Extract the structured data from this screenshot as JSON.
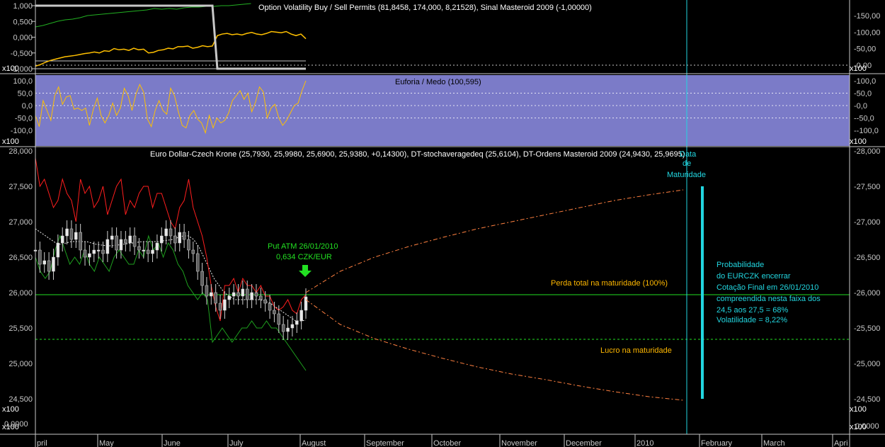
{
  "colors": {
    "background": "#000000",
    "panel_bg": "#7b7bc8",
    "grid_dotted": "#c8c8c8",
    "red_band": "#ff1e1e",
    "green_band": "#1ea01e",
    "yellow": "#ffc000",
    "cyan": "#22d6e0",
    "green_text": "#22e022",
    "orange": "#ff8040",
    "gold_text": "#ffb800",
    "light_green": "#90d890"
  },
  "panel1": {
    "title": "Option Volatility Buy / Sell Permits (81,8458, 174,000, 8,21528), Sinal Masteroid 2009 (-1,00000)",
    "scale_tag": "x100",
    "left_ticks": [
      "1,000",
      "0,500",
      "0,000",
      "-0,500",
      "-1,000"
    ],
    "right_ticks": [
      "150,00",
      "100,00",
      "50,00",
      "0,00"
    ]
  },
  "panel2": {
    "title": "Euforia / Medo (100,595)",
    "scale_tag": "x100",
    "ticks": [
      "100,0",
      "50,0",
      "0,0",
      "-50,0",
      "-100,0"
    ]
  },
  "panel3": {
    "title": "Euro Dollar-Czech Krone (25,7930, 25,9980, 25,6900, 25,9380, +0,14300), DT-stochaveragedeq (25,6104), DT-Ordens Masteroid 2009 (24,9430, 25,9695)",
    "scale_tag": "x100",
    "ticks": [
      "28,000",
      "27,500",
      "27,000",
      "26,500",
      "26,000",
      "25,500",
      "25,000",
      "24,500"
    ],
    "bottom_tick": "0,0000"
  },
  "annotations": {
    "put": [
      "Put ATM 26/01/2010",
      "0,634 CZK/EUR"
    ],
    "expiry": [
      "Data",
      "de",
      "Maturidade"
    ],
    "loss": "Perda total na maturidade (100%)",
    "profit": "Lucro na maturidade",
    "probability": [
      "Probabilidade",
      "do EURCZK encerrar",
      "Cotação Final em 26/01/2010",
      "compreendida nesta faixa dos",
      "24,5 aos 27,5 = 68%",
      "Volatilidade = 8,22%"
    ]
  },
  "x_axis": [
    "pril",
    "May",
    "June",
    "July",
    "August",
    "September",
    "October",
    "November",
    "December",
    "2010",
    "February",
    "March",
    "Apri"
  ],
  "chart_data": [
    {
      "type": "line",
      "title": "Option Volatility Buy / Sell Permits (81,8458, 174,000, 8,21528), Sinal Masteroid 2009 (-1,00000)",
      "series": [
        {
          "name": "Option Volatility Buy / Sell Permits",
          "color": "#ffc000",
          "values": [
            -0.92,
            -0.87,
            -0.8,
            -0.74,
            -0.7,
            -0.66,
            -0.62,
            -0.6,
            -0.58,
            -0.55,
            -0.52,
            -0.5,
            -0.47,
            -0.5,
            -0.43,
            -0.45,
            -0.36,
            -0.4,
            -0.38,
            -0.42,
            -0.35,
            -0.4,
            -0.38,
            -0.5,
            -0.48,
            -0.42,
            -0.4,
            -0.35,
            -0.37,
            -0.3,
            -0.3,
            -0.28,
            -0.35,
            -0.32,
            -0.27,
            -0.3,
            -0.28,
            0.05,
            0.1,
            0.12,
            0.08,
            0.1,
            0.07,
            0.12,
            0.15,
            0.1,
            0.08,
            0.12,
            0.18,
            0.16,
            0.14,
            0.18,
            0.1,
            0.05,
            0.1,
            -0.05
          ]
        },
        {
          "name": "Sinal Masteroid 2009",
          "color": "#c8c8c8",
          "values": [
            1,
            1,
            1,
            1,
            1,
            1,
            1,
            1,
            1,
            1,
            1,
            1,
            1,
            1,
            1,
            1,
            1,
            1,
            1,
            1,
            1,
            1,
            1,
            1,
            1,
            1,
            1,
            1,
            1,
            1,
            1,
            1,
            1,
            1,
            1,
            1,
            1,
            -1,
            -1,
            -1,
            -1,
            -1,
            -1,
            -1,
            -1,
            -1,
            -1,
            -1,
            -1,
            -1,
            -1,
            -1,
            -1,
            -1,
            -1,
            -1
          ]
        }
      ]
    },
    {
      "type": "line",
      "title": "Euforia / Medo (100,595)",
      "series": [
        {
          "name": "Euforia / Medo",
          "color": "#ffc000",
          "values": [
            -40,
            -85,
            20,
            -20,
            -60,
            40,
            75,
            5,
            35,
            40,
            -15,
            -10,
            -20,
            -10,
            -80,
            -15,
            30,
            -40,
            -70,
            -40,
            10,
            -40,
            -10,
            70,
            40,
            -20,
            45,
            85,
            55,
            -55,
            -85,
            -20,
            20,
            -20,
            -35,
            70,
            40,
            -25,
            -80,
            -90,
            -40,
            -20,
            -55,
            -70,
            -110,
            -40,
            -90,
            -50,
            -70,
            -60,
            -30,
            20,
            40,
            60,
            25,
            50,
            -25,
            15,
            75,
            55,
            -50,
            -10,
            5,
            -50,
            -80,
            -60,
            -30,
            0,
            10,
            60,
            100
          ]
        }
      ]
    },
    {
      "type": "line",
      "title": "Euro Dollar-Czech Krone (25,7930, 25,9980, 25,6900, 25,9380, +0,14300), DT-stochaveragedeq (25,6104), DT-Ordens Masteroid 2009 (24,9430, 25,9695)",
      "ylim": [
        24.4,
        28.0
      ],
      "categories": [
        "pril",
        "May",
        "June",
        "July",
        "August",
        "September",
        "October",
        "November",
        "December",
        "2010",
        "February",
        "March",
        "Apri"
      ],
      "series": [
        {
          "name": "Euro Dollar-Czech Krone",
          "type": "candlestick",
          "close": [
            26.6,
            26.4,
            26.45,
            26.3,
            26.5,
            26.7,
            26.8,
            26.9,
            26.75,
            26.85,
            26.6,
            26.5,
            26.55,
            26.6,
            26.6,
            26.55,
            26.75,
            26.8,
            26.6,
            26.75,
            26.7,
            26.8,
            26.65,
            26.6,
            26.6,
            26.55,
            26.6,
            26.7,
            26.8,
            26.9,
            26.8,
            26.7,
            26.85,
            26.75,
            26.6,
            26.55,
            26.3,
            26.1,
            25.95,
            26.0,
            25.85,
            25.75,
            25.9,
            25.95,
            26.0,
            25.95,
            26.05,
            25.9,
            26.0,
            25.95,
            25.9,
            25.85,
            25.75,
            25.7,
            25.55,
            25.45,
            25.5,
            25.55,
            25.6,
            25.75,
            25.94
          ]
        },
        {
          "name": "DT-stochaveragedeq",
          "color": "#f0f0f0",
          "values": [
            26.9,
            26.85,
            26.8,
            26.75,
            26.7,
            26.68,
            26.7,
            26.72,
            26.72,
            26.72,
            26.72,
            26.7,
            26.68,
            26.67,
            26.66,
            26.66,
            26.67,
            26.68,
            26.69,
            26.7,
            26.71,
            26.72,
            26.72,
            26.72,
            26.72,
            26.73,
            26.74,
            26.75,
            26.78,
            26.8,
            26.8,
            26.75,
            26.65,
            26.5,
            26.35,
            26.2,
            26.1,
            26.0,
            25.95,
            25.9,
            25.9,
            25.9,
            25.9,
            25.9,
            25.9,
            25.88,
            25.85,
            25.8,
            25.75,
            25.7,
            25.65,
            25.6,
            25.6,
            25.61
          ]
        },
        {
          "name": "DT-Ordens Masteroid 2009 (upper)",
          "color": "#ff1e1e",
          "values": [
            27.9,
            27.5,
            27.6,
            27.4,
            27.2,
            27.3,
            27.6,
            27.4,
            27.3,
            27.0,
            27.6,
            27.4,
            27.5,
            27.2,
            27.3,
            27.5,
            27.1,
            27.3,
            27.5,
            27.6,
            27.1,
            27.3,
            27.2,
            27.4,
            27.5,
            27.5,
            27.2,
            27.4,
            27.4,
            27.2,
            27.0,
            26.9,
            27.2,
            27.3,
            27.6,
            27.2,
            27.0,
            26.8,
            26.5,
            26.1,
            25.8,
            25.6,
            26.1,
            26.1,
            26.2,
            26.0,
            26.2,
            26.1,
            26.1,
            26.0,
            26.1,
            25.95,
            25.95,
            25.8,
            25.75,
            25.8,
            25.9,
            25.75,
            25.7,
            25.9,
            25.97
          ]
        },
        {
          "name": "DT-Ordens Masteroid 2009 (lower)",
          "color": "#1ea01e",
          "values": [
            26.5,
            26.3,
            26.2,
            26.3,
            26.6,
            26.8,
            26.6,
            26.4,
            26.5,
            26.4,
            26.6,
            26.4,
            26.3,
            26.5,
            26.4,
            26.3,
            26.5,
            26.6,
            26.5,
            26.4,
            26.4,
            26.6,
            26.5,
            26.8,
            26.6,
            26.7,
            26.5,
            26.7,
            26.6,
            26.4,
            26.3,
            26.1,
            26.0,
            25.9,
            26.0,
            25.9,
            25.3,
            25.4,
            25.5,
            25.4,
            25.3,
            25.4,
            25.5,
            25.5,
            25.6,
            25.5,
            25.5,
            25.6,
            25.5,
            25.5,
            25.4,
            25.3,
            25.2,
            25.1,
            25.0,
            24.9
          ]
        },
        {
          "name": "DT-Ordens Masteroid 2009 (level)",
          "color": "#22e022",
          "values": [
            25.9695
          ]
        },
        {
          "name": "DT-Ordens Masteroid 2009 (level 2)",
          "color": "#22e022",
          "values": [
            25.34
          ]
        },
        {
          "name": "Upper projection",
          "color": "#ff8040",
          "values": [
            26.0,
            26.3,
            26.5,
            26.65,
            26.78,
            26.9,
            27.0,
            27.1,
            27.2,
            27.3,
            27.38,
            27.45
          ]
        },
        {
          "name": "Lower projection",
          "color": "#ff8040",
          "values": [
            25.9,
            25.55,
            25.35,
            25.2,
            25.07,
            24.95,
            24.85,
            24.77,
            24.68,
            24.6,
            24.53,
            24.48
          ]
        }
      ]
    }
  ]
}
